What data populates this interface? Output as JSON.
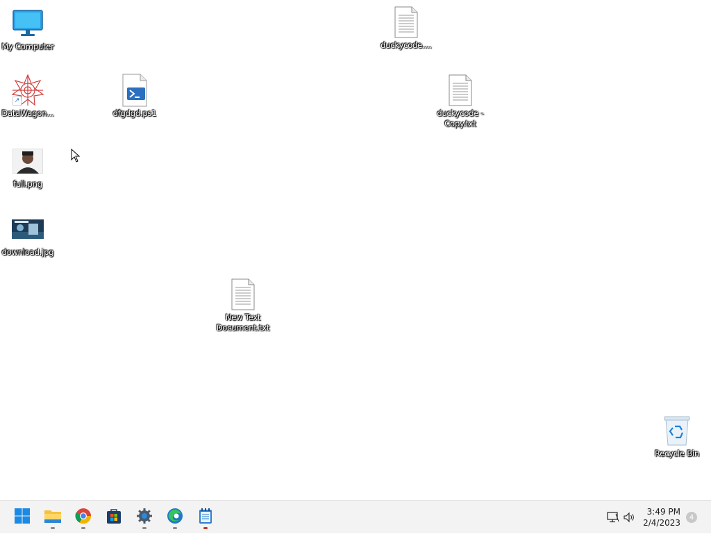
{
  "desktop": {
    "icons": [
      {
        "label": "My Computer",
        "icon": "monitor-icon"
      },
      {
        "label": "DataWagon...",
        "icon": "datawagon-app-icon"
      },
      {
        "label": "dfgdgd.ps1",
        "icon": "powershell-script-icon"
      },
      {
        "label": "full.png",
        "icon": "image-thumbnail-icon"
      },
      {
        "label": "download.jpg",
        "icon": "image-thumbnail-icon"
      },
      {
        "label": "New Text\nDocument.txt",
        "icon": "text-file-icon"
      },
      {
        "label": "duckycode....",
        "icon": "text-file-icon"
      },
      {
        "label": "duckycode -\nCopy.txt",
        "icon": "text-file-icon"
      },
      {
        "label": "Recycle Bin",
        "icon": "recycle-bin-icon"
      }
    ]
  },
  "taskbar": {
    "apps": [
      {
        "name": "Start",
        "icon": "windows-start-icon"
      },
      {
        "name": "File Explorer",
        "icon": "file-explorer-icon"
      },
      {
        "name": "Google Chrome",
        "icon": "chrome-icon"
      },
      {
        "name": "Microsoft Store",
        "icon": "store-icon"
      },
      {
        "name": "Settings",
        "icon": "gear-icon"
      },
      {
        "name": "Microsoft Edge",
        "icon": "edge-icon"
      },
      {
        "name": "Notepad",
        "icon": "notepad-icon"
      }
    ],
    "tray": {
      "time": "3:49 PM",
      "date": "2/4/2023",
      "notification_count": "4"
    }
  },
  "colors": {
    "desktop_bg": "#ffffff",
    "taskbar_bg": "#f3f3f3",
    "accent": "#0078d4"
  }
}
